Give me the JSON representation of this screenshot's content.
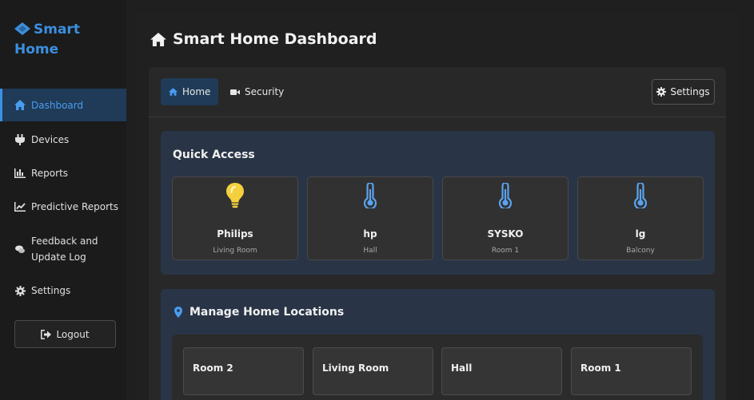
{
  "sidebar": {
    "brand": "Smart Home",
    "items": [
      {
        "label": "Dashboard",
        "icon": "home-icon",
        "active": true
      },
      {
        "label": "Devices",
        "icon": "plug-icon"
      },
      {
        "label": "Reports",
        "icon": "bar-chart-icon"
      },
      {
        "label": "Predictive Reports",
        "icon": "line-chart-icon"
      },
      {
        "label": "Feedback and Update Log",
        "icon": "comments-icon"
      },
      {
        "label": "Settings",
        "icon": "gear-icon"
      }
    ],
    "logout_label": "Logout"
  },
  "header": {
    "title": "Smart Home Dashboard"
  },
  "tabs": [
    {
      "label": "Home",
      "active": true
    },
    {
      "label": "Security"
    }
  ],
  "settings_button": "Settings",
  "quick_access": {
    "title": "Quick Access",
    "devices": [
      {
        "name": "Philips",
        "location": "Living Room",
        "icon": "lightbulb-icon",
        "icon_color": "#f4d03f"
      },
      {
        "name": "hp",
        "location": "Hall",
        "icon": "thermometer-icon",
        "icon_color": "#5aa2ee"
      },
      {
        "name": "SYSKO",
        "location": "Room 1",
        "icon": "thermometer-icon",
        "icon_color": "#5aa2ee"
      },
      {
        "name": "lg",
        "location": "Balcony",
        "icon": "thermometer-icon",
        "icon_color": "#5aa2ee"
      }
    ]
  },
  "locations": {
    "title": "Manage Home Locations",
    "rooms": [
      "Room 2",
      "Living Room",
      "Hall",
      "Room 1"
    ]
  },
  "colors": {
    "accent": "#3b8fe0",
    "card_bg": "#293546",
    "active_bg": "#1f3b57"
  }
}
